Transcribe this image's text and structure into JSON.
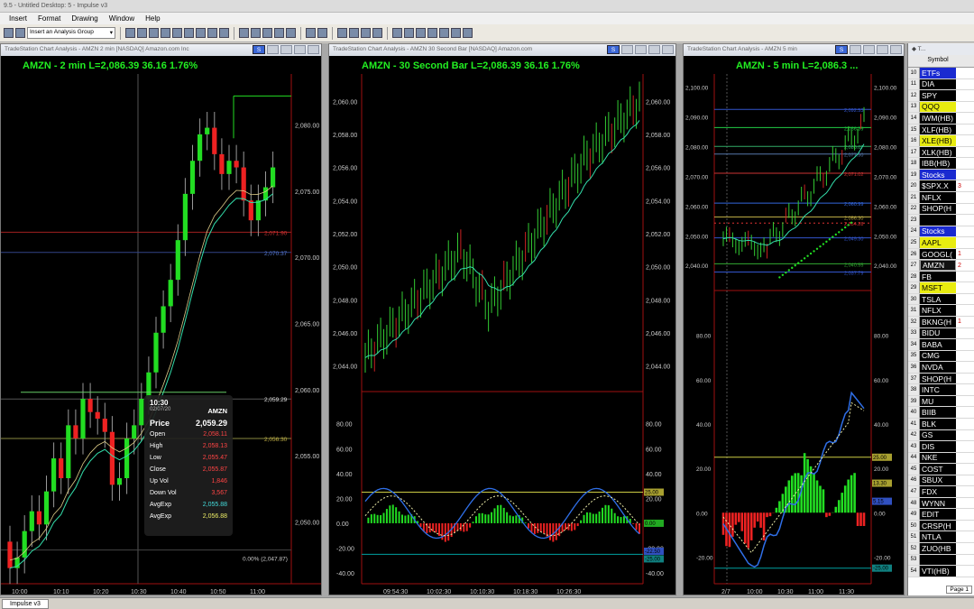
{
  "app": {
    "title": "9.5 - Untitled Desktop: 5 - Impulse v3",
    "menu": [
      "Insert",
      "Format",
      "Drawing",
      "Window",
      "Help"
    ],
    "toolbar_select": "Insert an Analysis Group",
    "status_tab": "Impulse v3"
  },
  "colors": {
    "up": "#22dd22",
    "down": "#ee2222",
    "ma": "#33ddaa",
    "blue": "#2f6fe8",
    "yellow_line": "#cccc44",
    "teal_line": "#00a0a0"
  },
  "windows": [
    {
      "title": "TradeStation Chart Analysis - AMZN 2 min [NASDAQ] Amazon.com Inc",
      "header": "AMZN - 2 min  L=2,086.39  36.16  1.76%",
      "price_axis": [
        "2,080.00",
        "2,075.00",
        "2,070.00",
        "2,065.00",
        "2,060.00",
        "2,055.00",
        "2,050.00"
      ],
      "price_tags": [
        "2,071.90",
        "2,070.37",
        "2,059.29",
        "2,056.30"
      ],
      "pct_label": "0.00% (2,047.87)",
      "time_axis": [
        "10:00",
        "10:10",
        "10:20",
        "10:30",
        "10:40",
        "10:50",
        "11:00"
      ],
      "chart_data": {
        "type": "candlestick",
        "series": [
          {
            "name": "AMZN 2 min",
            "open": [
              2048.5,
              2046.5,
              2047.3,
              2049.3,
              2050.8,
              2049.8,
              2052.3,
              2054.8,
              2053.3,
              2057.3,
              2056.3,
              2059.3,
              2058.3,
              2057.8,
              2056.8,
              2052.8,
              2053.3,
              2056.3,
              2057.3,
              2059.3,
              2061.3,
              2064.3,
              2066.3,
              2068.3,
              2071.3,
              2074.8,
              2077.3,
              2079.3,
              2079.8,
              2077.8,
              2076.3,
              2077.3,
              2076.8,
              2074.3,
              2072.8,
              2074.3,
              2075.3
            ],
            "close": [
              2046.5,
              2047.3,
              2049.3,
              2050.8,
              2049.8,
              2052.3,
              2054.8,
              2053.3,
              2057.3,
              2056.3,
              2059.3,
              2058.3,
              2057.8,
              2056.8,
              2052.8,
              2053.3,
              2056.3,
              2057.3,
              2059.3,
              2061.3,
              2064.3,
              2066.3,
              2068.3,
              2071.3,
              2074.8,
              2077.3,
              2079.3,
              2079.8,
              2077.8,
              2076.3,
              2077.3,
              2076.8,
              2074.3,
              2072.8,
              2074.3,
              2075.3,
              2076.8
            ]
          }
        ]
      }
    },
    {
      "title": "TradeStation Chart Analysis - AMZN 30 Second Bar [NASDAQ] Amazon.com",
      "header": "AMZN - 30 Second Bar  L=2,086.39  36.16  1.76%",
      "price_axis": [
        "2,060.00",
        "2,058.00",
        "2,056.00",
        "2,054.00",
        "2,052.00",
        "2,050.00",
        "2,048.00",
        "2,046.00",
        "2,044.00"
      ],
      "osc_axis": [
        "80.00",
        "60.00",
        "40.00",
        "20.00",
        "0.00",
        "-20.00",
        "-40.00"
      ],
      "osc_tags": [
        "25.00",
        "0.00",
        "-22.50",
        "-25.00"
      ],
      "time_axis": [
        "09:54:30",
        "10:02:30",
        "10:10:30",
        "10:18:30",
        "10:26:30"
      ]
    },
    {
      "title": "TradeStation Chart Analysis - AMZN 5 min",
      "header": "AMZN - 5 min  L=2,086.3 ...",
      "price_axis": [
        "2,100.00",
        "2,090.00",
        "2,080.00",
        "2,070.00",
        "2,060.00",
        "2,050.00",
        "2,040.00"
      ],
      "price_tags": [
        "2,092.53",
        "2,080.07",
        "2,086.39",
        "2,077.50",
        "2,071.02",
        "2,060.99",
        "2,056.30",
        "2,054.28",
        "2,049.30",
        "2,040.55",
        "2,037.79"
      ],
      "osc_axis": [
        "80.00",
        "60.00",
        "40.00",
        "20.00",
        "0.00",
        "-20.00"
      ],
      "osc_tags": [
        "25.00",
        "13.30",
        "5.15",
        "-25.00"
      ],
      "time_axis": [
        "2/7",
        "10:00",
        "10:30",
        "11:00",
        "11:30"
      ]
    }
  ],
  "tooltip": {
    "time": "10:30",
    "date": "02/07/20",
    "symbol": "AMZN",
    "price_label": "Price",
    "price": "2,059.29",
    "rows": [
      {
        "k": "Open",
        "v": "2,058.11"
      },
      {
        "k": "High",
        "v": "2,058.13"
      },
      {
        "k": "Low",
        "v": "2,055.47"
      },
      {
        "k": "Close",
        "v": "2,055.87"
      },
      {
        "k": "Up Vol",
        "v": "1,846"
      },
      {
        "k": "Down Vol",
        "v": "3,567"
      },
      {
        "k": "AvgExp",
        "v": "2,055.88"
      },
      {
        "k": "AvgExp",
        "v": "2,056.88"
      }
    ]
  },
  "watchlist": {
    "column": "Symbol",
    "page": "Page 1",
    "rows": [
      {
        "n": "10",
        "s": "ETFs",
        "t": "group",
        "v": ""
      },
      {
        "n": "11",
        "s": "DIA",
        "t": "",
        "v": ""
      },
      {
        "n": "12",
        "s": "SPY",
        "t": "",
        "v": ""
      },
      {
        "n": "13",
        "s": "QQQ",
        "t": "hl",
        "v": ""
      },
      {
        "n": "14",
        "s": "IWM(HB)",
        "t": "",
        "v": ""
      },
      {
        "n": "15",
        "s": "XLF(HB)",
        "t": "",
        "v": ""
      },
      {
        "n": "16",
        "s": "XLE(HB)",
        "t": "hl",
        "v": ""
      },
      {
        "n": "17",
        "s": "XLK(HB)",
        "t": "",
        "v": ""
      },
      {
        "n": "18",
        "s": "IBB(HB)",
        "t": "",
        "v": ""
      },
      {
        "n": "19",
        "s": "Stocks",
        "t": "group",
        "v": ""
      },
      {
        "n": "20",
        "s": "$SPX.X",
        "t": "",
        "v": "3"
      },
      {
        "n": "21",
        "s": "NFLX",
        "t": "",
        "v": ""
      },
      {
        "n": "22",
        "s": "SHOP(H",
        "t": "",
        "v": ""
      },
      {
        "n": "23",
        "s": "",
        "t": "",
        "v": ""
      },
      {
        "n": "24",
        "s": "Stocks",
        "t": "group",
        "v": ""
      },
      {
        "n": "25",
        "s": "AAPL",
        "t": "hl",
        "v": ""
      },
      {
        "n": "26",
        "s": "GOOGL(",
        "t": "",
        "v": "1"
      },
      {
        "n": "27",
        "s": "AMZN",
        "t": "sel",
        "v": "2"
      },
      {
        "n": "28",
        "s": "FB",
        "t": "",
        "v": ""
      },
      {
        "n": "29",
        "s": "MSFT",
        "t": "hl",
        "v": ""
      },
      {
        "n": "30",
        "s": "TSLA",
        "t": "",
        "v": ""
      },
      {
        "n": "31",
        "s": "NFLX",
        "t": "",
        "v": ""
      },
      {
        "n": "32",
        "s": "BKNG(H",
        "t": "",
        "v": "1"
      },
      {
        "n": "33",
        "s": "BIDU",
        "t": "",
        "v": ""
      },
      {
        "n": "34",
        "s": "BABA",
        "t": "",
        "v": ""
      },
      {
        "n": "35",
        "s": "CMG",
        "t": "",
        "v": ""
      },
      {
        "n": "36",
        "s": "NVDA",
        "t": "",
        "v": ""
      },
      {
        "n": "37",
        "s": "SHOP(H",
        "t": "",
        "v": ""
      },
      {
        "n": "38",
        "s": "INTC",
        "t": "",
        "v": ""
      },
      {
        "n": "39",
        "s": "MU",
        "t": "",
        "v": ""
      },
      {
        "n": "40",
        "s": "BIIB",
        "t": "",
        "v": ""
      },
      {
        "n": "41",
        "s": "BLK",
        "t": "",
        "v": ""
      },
      {
        "n": "42",
        "s": "GS",
        "t": "",
        "v": ""
      },
      {
        "n": "43",
        "s": "DIS",
        "t": "",
        "v": ""
      },
      {
        "n": "44",
        "s": "NKE",
        "t": "",
        "v": ""
      },
      {
        "n": "45",
        "s": "COST",
        "t": "",
        "v": ""
      },
      {
        "n": "46",
        "s": "SBUX",
        "t": "",
        "v": ""
      },
      {
        "n": "47",
        "s": "FDX",
        "t": "",
        "v": ""
      },
      {
        "n": "48",
        "s": "WYNN",
        "t": "",
        "v": ""
      },
      {
        "n": "49",
        "s": "EDIT",
        "t": "",
        "v": ""
      },
      {
        "n": "50",
        "s": "CRSP(H",
        "t": "",
        "v": ""
      },
      {
        "n": "51",
        "s": "NTLA",
        "t": "",
        "v": ""
      },
      {
        "n": "52",
        "s": "ZUO(HB",
        "t": "",
        "v": ""
      },
      {
        "n": "53",
        "s": "",
        "t": "",
        "v": ""
      },
      {
        "n": "54",
        "s": "VTI(HB)",
        "t": "",
        "v": ""
      }
    ]
  }
}
